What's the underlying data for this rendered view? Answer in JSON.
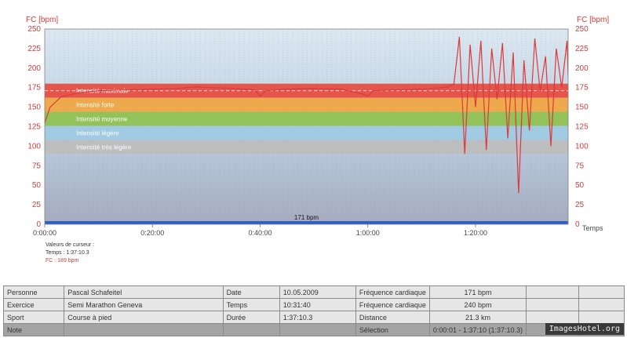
{
  "chart_data": {
    "type": "area",
    "ylabel_left": "FC [bpm]",
    "ylabel_right": "FC [bpm]",
    "xlabel": "Temps",
    "ylim": [
      0,
      250
    ],
    "y_ticks": [
      "0",
      "25",
      "50",
      "75",
      "100",
      "125",
      "150",
      "175",
      "200",
      "225",
      "250"
    ],
    "x_ticks": [
      {
        "label": "0:00:00",
        "minutes": 0
      },
      {
        "label": "0:20:00",
        "minutes": 20
      },
      {
        "label": "0:40:00",
        "minutes": 40
      },
      {
        "label": "1:00:00",
        "minutes": 60
      },
      {
        "label": "1:20:00",
        "minutes": 80
      }
    ],
    "xlim_minutes": [
      0,
      97.2
    ],
    "zones": [
      {
        "name": "Intensité maximale",
        "lower": 162,
        "upper": 180,
        "color": "#e84a3e"
      },
      {
        "name": "Intensité forte",
        "lower": 144,
        "upper": 162,
        "color": "#f2a540"
      },
      {
        "name": "Intensité moyenne",
        "lower": 126,
        "upper": 144,
        "color": "#8fc04f"
      },
      {
        "name": "Intensité légère",
        "lower": 108,
        "upper": 126,
        "color": "#9ecae3"
      },
      {
        "name": "Intensité très légère",
        "lower": 90,
        "upper": 108,
        "color": "#bdbdbd"
      }
    ],
    "average_line": 171,
    "average_label": "171 bpm",
    "series": [
      {
        "points": [
          [
            0,
            130
          ],
          [
            1,
            150
          ],
          [
            3,
            163
          ],
          [
            6,
            168
          ],
          [
            10,
            171
          ],
          [
            15,
            172
          ],
          [
            20,
            173
          ],
          [
            25,
            174
          ],
          [
            28,
            176
          ],
          [
            30,
            175
          ],
          [
            35,
            174
          ],
          [
            39,
            172
          ],
          [
            40,
            164
          ],
          [
            41,
            171
          ],
          [
            45,
            173
          ],
          [
            50,
            174
          ],
          [
            55,
            173
          ],
          [
            59,
            167
          ],
          [
            60,
            164
          ],
          [
            61,
            171
          ],
          [
            65,
            172
          ],
          [
            70,
            173
          ],
          [
            72,
            174
          ],
          [
            74,
            175
          ],
          [
            75,
            176
          ],
          [
            76,
            180
          ],
          [
            77,
            240
          ],
          [
            78,
            90
          ],
          [
            79,
            230
          ],
          [
            80,
            150
          ],
          [
            81,
            235
          ],
          [
            82,
            95
          ],
          [
            83,
            225
          ],
          [
            84,
            160
          ],
          [
            85,
            232
          ],
          [
            86,
            110
          ],
          [
            87,
            220
          ],
          [
            88,
            40
          ],
          [
            89,
            210
          ],
          [
            90,
            120
          ],
          [
            91,
            238
          ],
          [
            92,
            170
          ],
          [
            93,
            215
          ],
          [
            94,
            100
          ],
          [
            95,
            225
          ],
          [
            96,
            175
          ],
          [
            97,
            235
          ],
          [
            97.2,
            190
          ]
        ]
      }
    ]
  },
  "cursor": {
    "title": "Valeurs de curseur :",
    "time": "Temps : 1:37:10.3",
    "hr": "FC : 189 bpm"
  },
  "info_table": {
    "rows": [
      [
        "Personne",
        "Pascal Schafeitel",
        "Date",
        "10.05.2009",
        "Fréquence cardiaque",
        "171 bpm",
        "",
        ""
      ],
      [
        "Exercice",
        "Semi Marathon Geneva",
        "Temps",
        "10:31:40",
        "Fréquence cardiaque",
        "240 bpm",
        "",
        ""
      ],
      [
        "Sport",
        "Course à pied",
        "Durée",
        "1:37:10.3",
        "Distance",
        "21.3 km",
        "",
        ""
      ],
      [
        "Note",
        "",
        "",
        "",
        "Sélection",
        "0:00:01 - 1:37:10 (1:37:10.3)",
        "",
        ""
      ]
    ]
  },
  "watermark": "ImagesHotel.org",
  "colors": {
    "plot_bg_top": "#d4e3ee",
    "plot_bg_bottom": "#a3a9bd",
    "hr_line": "#d93a3a",
    "baseline": "#2f5fc6"
  }
}
